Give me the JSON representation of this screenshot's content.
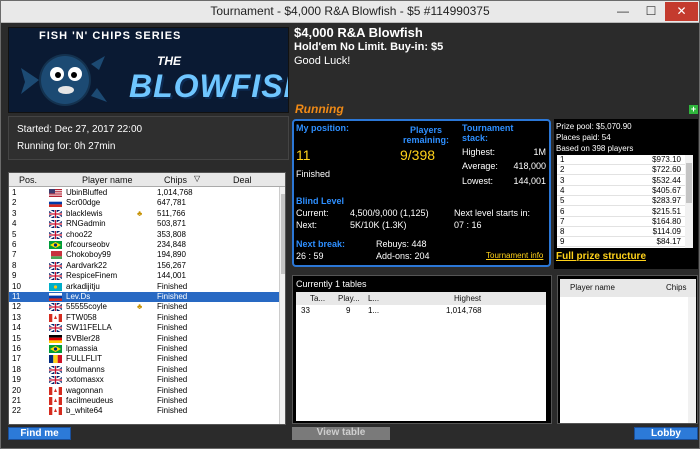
{
  "window": {
    "title": "Tournament - $4,000 R&A Blowfish - $5 #114990375",
    "min": "—",
    "max": "☐",
    "close": "✕"
  },
  "banner": {
    "series": "FISH 'N' CHIPS SERIES",
    "the": "THE",
    "name": "BLOWFISH"
  },
  "tournament": {
    "name": "$4,000 R&A Blowfish",
    "game": "Hold'em No Limit. Buy-in: $5",
    "greeting": "Good Luck!",
    "status": "Running"
  },
  "timing": {
    "started": "Started: Dec 27, 2017 22:00",
    "running": "Running for: 0h 27min"
  },
  "players_table": {
    "headers": {
      "pos": "Pos.",
      "name": "Player name",
      "chips": "Chips",
      "deal": "Deal"
    },
    "rows": [
      {
        "pos": "1",
        "flag": "us",
        "name": "UbinBluffed",
        "chips": "1,014,768",
        "coin": false,
        "selected": false
      },
      {
        "pos": "2",
        "flag": "ru",
        "name": "Scr00dge",
        "chips": "647,781",
        "coin": false,
        "selected": false
      },
      {
        "pos": "3",
        "flag": "gb",
        "name": "blacklewis",
        "chips": "511,766",
        "coin": true,
        "selected": false
      },
      {
        "pos": "4",
        "flag": "gb",
        "name": "RNGadmin",
        "chips": "503,871",
        "coin": false,
        "selected": false
      },
      {
        "pos": "5",
        "flag": "gb",
        "name": "choo22",
        "chips": "353,808",
        "coin": false,
        "selected": false
      },
      {
        "pos": "6",
        "flag": "br",
        "name": "ofcourseobv",
        "chips": "234,848",
        "coin": false,
        "selected": false
      },
      {
        "pos": "7",
        "flag": "by",
        "name": "Chokoboy99",
        "chips": "194,890",
        "coin": false,
        "selected": false
      },
      {
        "pos": "8",
        "flag": "gb",
        "name": "Aardvark22",
        "chips": "156,267",
        "coin": false,
        "selected": false
      },
      {
        "pos": "9",
        "flag": "gb",
        "name": "RespiceFinem",
        "chips": "144,001",
        "coin": false,
        "selected": false
      },
      {
        "pos": "10",
        "flag": "kz",
        "name": "arkadijitju",
        "chips": "Finished",
        "coin": false,
        "selected": false
      },
      {
        "pos": "11",
        "flag": "ru",
        "name": "Lev.Ds",
        "chips": "Finished",
        "coin": false,
        "selected": true
      },
      {
        "pos": "12",
        "flag": "gb",
        "name": "55555coyle",
        "chips": "Finished",
        "coin": true,
        "selected": false
      },
      {
        "pos": "13",
        "flag": "ca",
        "name": "FTW058",
        "chips": "Finished",
        "coin": false,
        "selected": false
      },
      {
        "pos": "14",
        "flag": "gb",
        "name": "SW11FELLA",
        "chips": "Finished",
        "coin": false,
        "selected": false
      },
      {
        "pos": "15",
        "flag": "de",
        "name": "BVBler28",
        "chips": "Finished",
        "coin": false,
        "selected": false
      },
      {
        "pos": "16",
        "flag": "br",
        "name": "lpmassia",
        "chips": "Finished",
        "coin": false,
        "selected": false
      },
      {
        "pos": "17",
        "flag": "ro",
        "name": "FULLFLIT",
        "chips": "Finished",
        "coin": false,
        "selected": false
      },
      {
        "pos": "18",
        "flag": "gb",
        "name": "koulmanns",
        "chips": "Finished",
        "coin": false,
        "selected": false
      },
      {
        "pos": "19",
        "flag": "gb",
        "name": "xxtomasxx",
        "chips": "Finished",
        "coin": false,
        "selected": false
      },
      {
        "pos": "20",
        "flag": "ca",
        "name": "wagonnan",
        "chips": "Finished",
        "coin": false,
        "selected": false
      },
      {
        "pos": "21",
        "flag": "ca",
        "name": "facilmeudeus",
        "chips": "Finished",
        "coin": false,
        "selected": false
      },
      {
        "pos": "22",
        "flag": "ca",
        "name": "b_white64",
        "chips": "Finished",
        "coin": false,
        "selected": false
      }
    ]
  },
  "my_position": {
    "label": "My position:",
    "value": "11",
    "status": "Finished",
    "players_label": "Players remaining:",
    "players_value": "9/398",
    "stack_label": "Tournament stack:",
    "highest_label": "Highest:",
    "highest_value": "1M",
    "average_label": "Average:",
    "average_value": "418,000",
    "lowest_label": "Lowest:",
    "lowest_value": "144,001",
    "blind_label": "Blind Level",
    "current_label": "Current:",
    "current_value": "4,500/9,000 (1,125)",
    "next_label": "Next:",
    "next_value": "5K/10K (1.3K)",
    "next_level_label": "Next level starts in:",
    "next_level_value": "07 : 16",
    "break_label": "Next break:",
    "break_value": "26 : 59",
    "rebuys": "Rebuys: 448",
    "addons": "Add-ons: 204",
    "info_link": "Tournament info"
  },
  "prize": {
    "pool": "Prize pool: $5,070.90",
    "places": "Places paid: 54",
    "based": "Based on 398 players",
    "rows": [
      {
        "place": "1",
        "amount": "$973.10"
      },
      {
        "place": "2",
        "amount": "$722.60"
      },
      {
        "place": "3",
        "amount": "$532.44"
      },
      {
        "place": "4",
        "amount": "$405.67"
      },
      {
        "place": "5",
        "amount": "$283.97"
      },
      {
        "place": "6",
        "amount": "$215.51"
      },
      {
        "place": "7",
        "amount": "$164.80"
      },
      {
        "place": "8",
        "amount": "$114.09"
      },
      {
        "place": "9",
        "amount": "$84.17"
      }
    ],
    "full_link": "Full prize structure"
  },
  "tables": {
    "caption": "Currently 1 tables",
    "headers": {
      "table": "Ta...",
      "players": "Play...",
      "low": "L...",
      "highest": "Highest"
    },
    "row": {
      "table": "33",
      "players": "9",
      "low": "1...",
      "highest": "1,014,768"
    }
  },
  "table_players": {
    "headers": {
      "name": "Player name",
      "chips": "Chips"
    }
  },
  "buttons": {
    "find_me": "Find me",
    "view_table": "View table",
    "lobby": "Lobby",
    "plus": "+"
  },
  "colors": {
    "accent_blue": "#2b77d6",
    "highlight_yellow": "#ffd21a",
    "running_orange": "#f08a16",
    "selected_row": "#2869c3"
  }
}
